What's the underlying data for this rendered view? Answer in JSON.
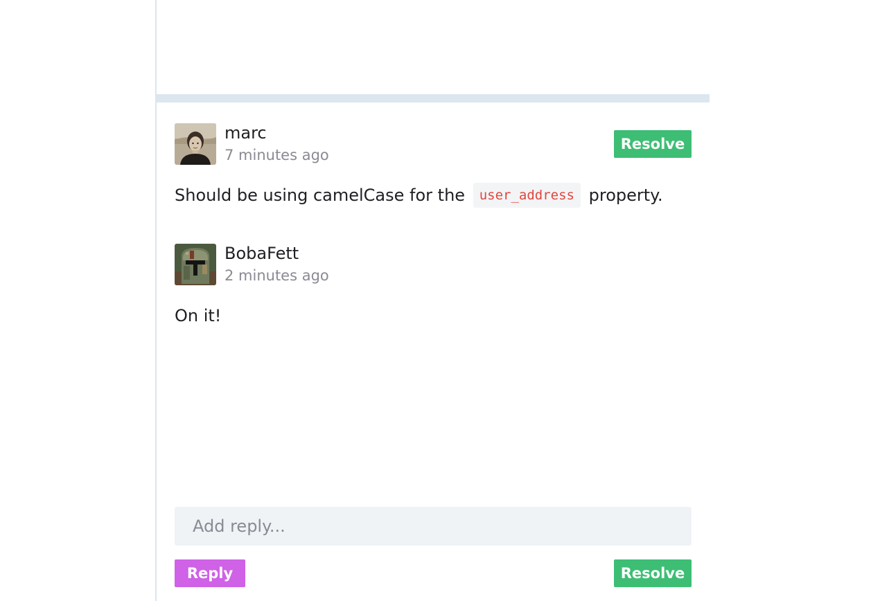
{
  "comments": [
    {
      "author": "marc",
      "time": "7 minutes ago",
      "avatar_icon": "avatar-marc-photo",
      "body_before": "Should be using camelCase for the",
      "body_code": "user_address",
      "body_after": "property.",
      "resolve_label": "Resolve"
    },
    {
      "author": "BobaFett",
      "time": "2 minutes ago",
      "avatar_icon": "avatar-bobafett-helmet",
      "body": "On it!"
    }
  ],
  "reply": {
    "placeholder": "Add reply...",
    "reply_label": "Reply",
    "resolve_label": "Resolve"
  },
  "colors": {
    "resolve": "#3dbe74",
    "reply": "#cf62e6",
    "code_text": "#e2453b",
    "divider": "#dce6ef"
  }
}
